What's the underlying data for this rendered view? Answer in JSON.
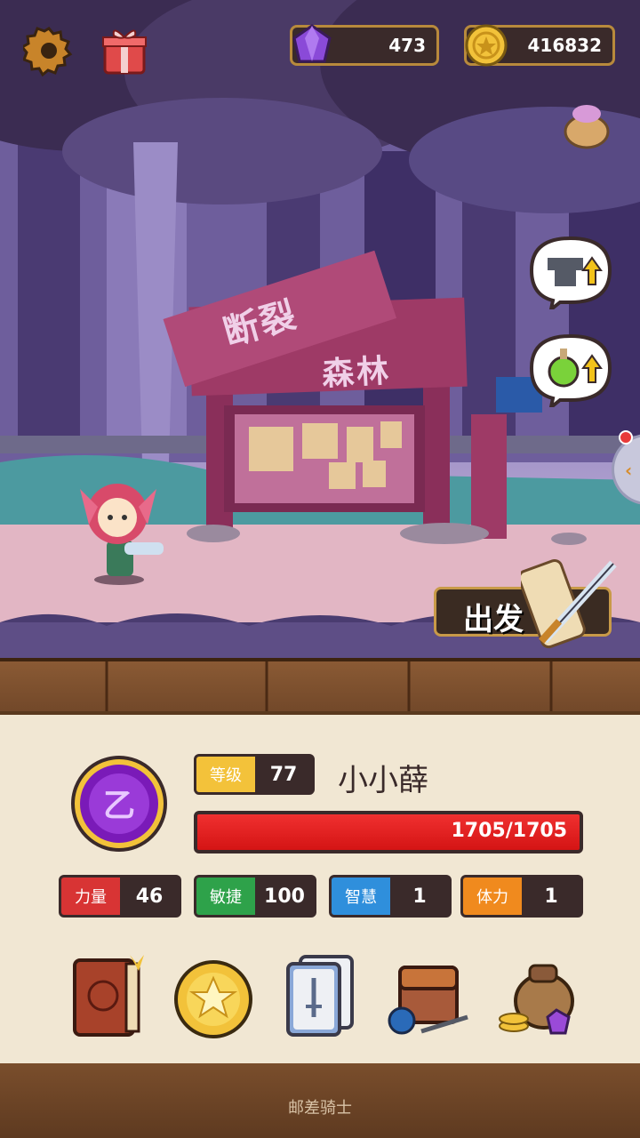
{
  "top_bar": {
    "gems": "473",
    "coins": "416832"
  },
  "scene": {
    "sign_line1": "断裂",
    "sign_line2": "森林",
    "go_button": "出发"
  },
  "player": {
    "level_label": "等级",
    "level": "77",
    "name": "小小薛",
    "hp_text": "1705/1705",
    "hp_fraction": 1.0,
    "emblem_letter": "乙"
  },
  "stats": [
    {
      "label": "力量",
      "value": "46",
      "color": "#d83434"
    },
    {
      "label": "敏捷",
      "value": "100",
      "color": "#2ea24a"
    },
    {
      "label": "智慧",
      "value": "1",
      "color": "#2f8fdc"
    },
    {
      "label": "体力",
      "value": "1",
      "color": "#f08a1e"
    }
  ],
  "menu": [
    {
      "icon": "journal-book-icon"
    },
    {
      "icon": "star-coin-icon"
    },
    {
      "icon": "card-deck-icon"
    },
    {
      "icon": "backpack-equipment-icon"
    },
    {
      "icon": "treasure-bag-icon"
    }
  ],
  "footer": "邮差骑士",
  "colors": {
    "gold": "#c89a48",
    "panel": "#f1e7d3",
    "hp_red": "#e42020"
  }
}
